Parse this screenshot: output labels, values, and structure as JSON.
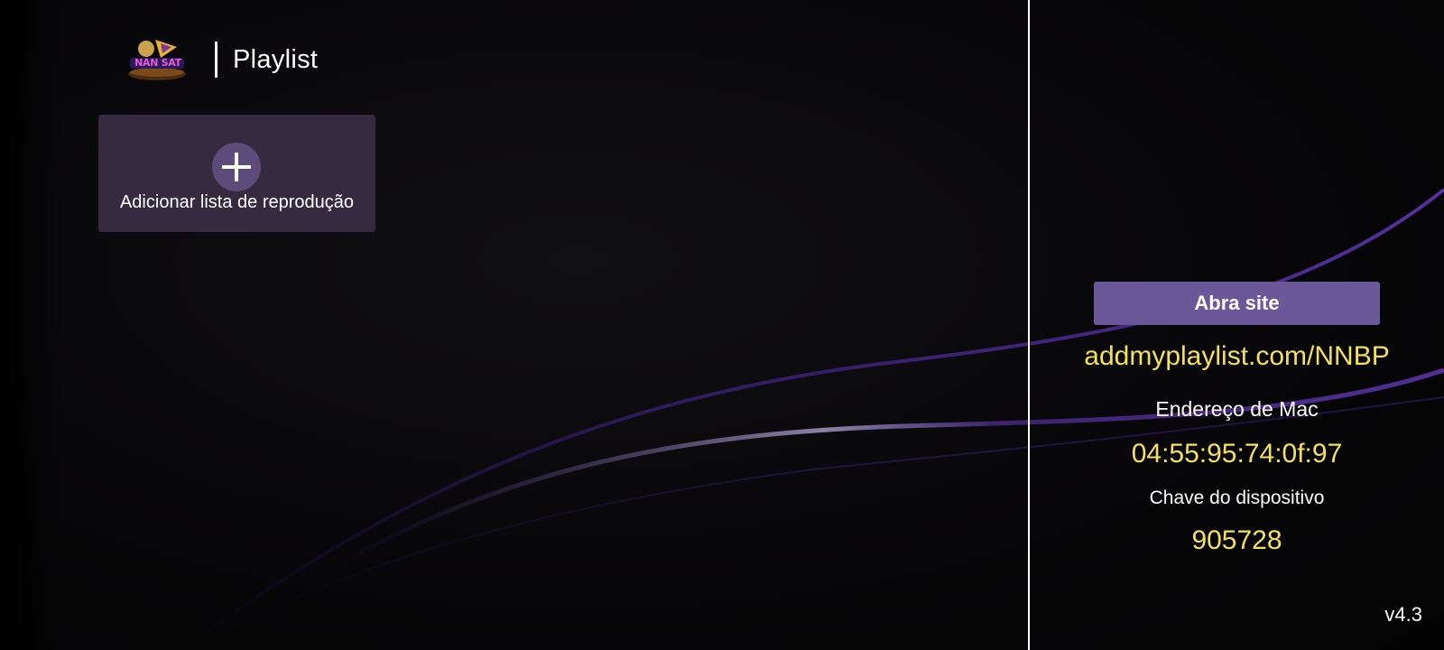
{
  "header": {
    "logo_text": "NAN SAT",
    "title": "Playlist"
  },
  "add_playlist": {
    "icon": "plus-icon",
    "label": "Adicionar lista de reprodução"
  },
  "device_info": {
    "open_site_label": "Abra site",
    "site_url": "addmyplaylist.com/NNBP",
    "mac_label": "Endereço de Mac",
    "mac_value": "04:55:95:74:0f:97",
    "device_key_label": "Chave do dispositivo",
    "device_key_value": "905728"
  },
  "version": "v4.3",
  "colors": {
    "card_bg": "#362a40",
    "plus_circle": "#5d4b79",
    "button_bg": "#6b5899",
    "highlight_text": "#f3e05c",
    "wave": "#4a2a8a"
  }
}
